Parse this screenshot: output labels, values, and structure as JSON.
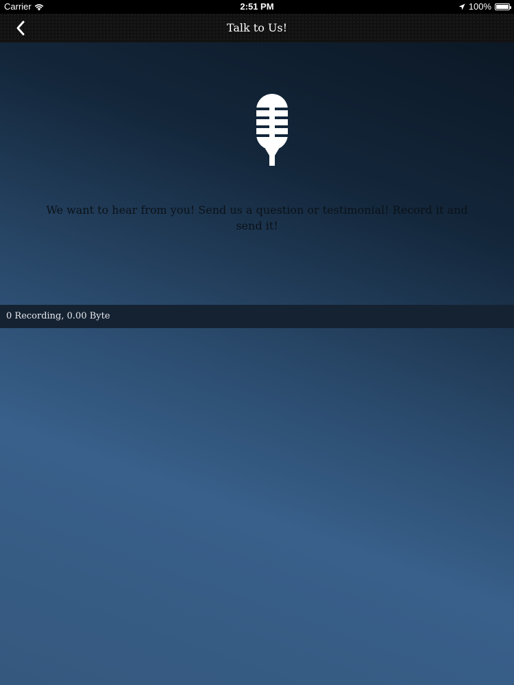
{
  "status_bar": {
    "carrier": "Carrier",
    "time": "2:51 PM",
    "battery_text": "100%",
    "battery_level": 1.0
  },
  "nav": {
    "title": "Talk to Us!",
    "back_icon": "chevron-left-icon"
  },
  "main": {
    "icon": "microphone-icon",
    "message": "We want to hear from you! Send us a question or testimonial! Record it and send it!"
  },
  "recordings": {
    "summary": "0 Recording, 0.00 Byte"
  },
  "colors": {
    "nav_background": "#111111",
    "recording_bar": "#152232",
    "gradient_dark": "#0a1521",
    "gradient_light": "#38608a"
  }
}
